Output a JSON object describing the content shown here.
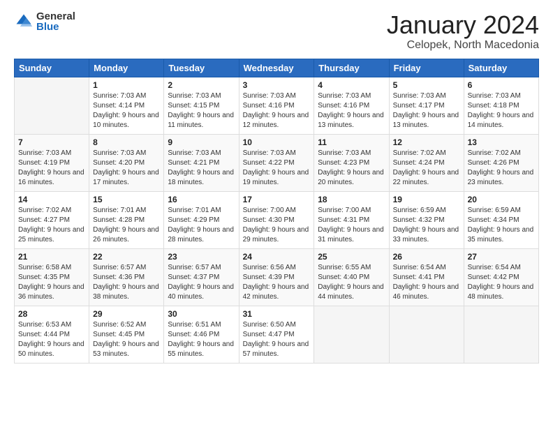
{
  "logo": {
    "general": "General",
    "blue": "Blue"
  },
  "title": "January 2024",
  "location": "Celopek, North Macedonia",
  "days_of_week": [
    "Sunday",
    "Monday",
    "Tuesday",
    "Wednesday",
    "Thursday",
    "Friday",
    "Saturday"
  ],
  "weeks": [
    [
      {
        "day": "",
        "sunrise": "",
        "sunset": "",
        "daylight": ""
      },
      {
        "day": "1",
        "sunrise": "Sunrise: 7:03 AM",
        "sunset": "Sunset: 4:14 PM",
        "daylight": "Daylight: 9 hours and 10 minutes."
      },
      {
        "day": "2",
        "sunrise": "Sunrise: 7:03 AM",
        "sunset": "Sunset: 4:15 PM",
        "daylight": "Daylight: 9 hours and 11 minutes."
      },
      {
        "day": "3",
        "sunrise": "Sunrise: 7:03 AM",
        "sunset": "Sunset: 4:16 PM",
        "daylight": "Daylight: 9 hours and 12 minutes."
      },
      {
        "day": "4",
        "sunrise": "Sunrise: 7:03 AM",
        "sunset": "Sunset: 4:16 PM",
        "daylight": "Daylight: 9 hours and 13 minutes."
      },
      {
        "day": "5",
        "sunrise": "Sunrise: 7:03 AM",
        "sunset": "Sunset: 4:17 PM",
        "daylight": "Daylight: 9 hours and 13 minutes."
      },
      {
        "day": "6",
        "sunrise": "Sunrise: 7:03 AM",
        "sunset": "Sunset: 4:18 PM",
        "daylight": "Daylight: 9 hours and 14 minutes."
      }
    ],
    [
      {
        "day": "7",
        "sunrise": "Sunrise: 7:03 AM",
        "sunset": "Sunset: 4:19 PM",
        "daylight": "Daylight: 9 hours and 16 minutes."
      },
      {
        "day": "8",
        "sunrise": "Sunrise: 7:03 AM",
        "sunset": "Sunset: 4:20 PM",
        "daylight": "Daylight: 9 hours and 17 minutes."
      },
      {
        "day": "9",
        "sunrise": "Sunrise: 7:03 AM",
        "sunset": "Sunset: 4:21 PM",
        "daylight": "Daylight: 9 hours and 18 minutes."
      },
      {
        "day": "10",
        "sunrise": "Sunrise: 7:03 AM",
        "sunset": "Sunset: 4:22 PM",
        "daylight": "Daylight: 9 hours and 19 minutes."
      },
      {
        "day": "11",
        "sunrise": "Sunrise: 7:03 AM",
        "sunset": "Sunset: 4:23 PM",
        "daylight": "Daylight: 9 hours and 20 minutes."
      },
      {
        "day": "12",
        "sunrise": "Sunrise: 7:02 AM",
        "sunset": "Sunset: 4:24 PM",
        "daylight": "Daylight: 9 hours and 22 minutes."
      },
      {
        "day": "13",
        "sunrise": "Sunrise: 7:02 AM",
        "sunset": "Sunset: 4:26 PM",
        "daylight": "Daylight: 9 hours and 23 minutes."
      }
    ],
    [
      {
        "day": "14",
        "sunrise": "Sunrise: 7:02 AM",
        "sunset": "Sunset: 4:27 PM",
        "daylight": "Daylight: 9 hours and 25 minutes."
      },
      {
        "day": "15",
        "sunrise": "Sunrise: 7:01 AM",
        "sunset": "Sunset: 4:28 PM",
        "daylight": "Daylight: 9 hours and 26 minutes."
      },
      {
        "day": "16",
        "sunrise": "Sunrise: 7:01 AM",
        "sunset": "Sunset: 4:29 PM",
        "daylight": "Daylight: 9 hours and 28 minutes."
      },
      {
        "day": "17",
        "sunrise": "Sunrise: 7:00 AM",
        "sunset": "Sunset: 4:30 PM",
        "daylight": "Daylight: 9 hours and 29 minutes."
      },
      {
        "day": "18",
        "sunrise": "Sunrise: 7:00 AM",
        "sunset": "Sunset: 4:31 PM",
        "daylight": "Daylight: 9 hours and 31 minutes."
      },
      {
        "day": "19",
        "sunrise": "Sunrise: 6:59 AM",
        "sunset": "Sunset: 4:32 PM",
        "daylight": "Daylight: 9 hours and 33 minutes."
      },
      {
        "day": "20",
        "sunrise": "Sunrise: 6:59 AM",
        "sunset": "Sunset: 4:34 PM",
        "daylight": "Daylight: 9 hours and 35 minutes."
      }
    ],
    [
      {
        "day": "21",
        "sunrise": "Sunrise: 6:58 AM",
        "sunset": "Sunset: 4:35 PM",
        "daylight": "Daylight: 9 hours and 36 minutes."
      },
      {
        "day": "22",
        "sunrise": "Sunrise: 6:57 AM",
        "sunset": "Sunset: 4:36 PM",
        "daylight": "Daylight: 9 hours and 38 minutes."
      },
      {
        "day": "23",
        "sunrise": "Sunrise: 6:57 AM",
        "sunset": "Sunset: 4:37 PM",
        "daylight": "Daylight: 9 hours and 40 minutes."
      },
      {
        "day": "24",
        "sunrise": "Sunrise: 6:56 AM",
        "sunset": "Sunset: 4:39 PM",
        "daylight": "Daylight: 9 hours and 42 minutes."
      },
      {
        "day": "25",
        "sunrise": "Sunrise: 6:55 AM",
        "sunset": "Sunset: 4:40 PM",
        "daylight": "Daylight: 9 hours and 44 minutes."
      },
      {
        "day": "26",
        "sunrise": "Sunrise: 6:54 AM",
        "sunset": "Sunset: 4:41 PM",
        "daylight": "Daylight: 9 hours and 46 minutes."
      },
      {
        "day": "27",
        "sunrise": "Sunrise: 6:54 AM",
        "sunset": "Sunset: 4:42 PM",
        "daylight": "Daylight: 9 hours and 48 minutes."
      }
    ],
    [
      {
        "day": "28",
        "sunrise": "Sunrise: 6:53 AM",
        "sunset": "Sunset: 4:44 PM",
        "daylight": "Daylight: 9 hours and 50 minutes."
      },
      {
        "day": "29",
        "sunrise": "Sunrise: 6:52 AM",
        "sunset": "Sunset: 4:45 PM",
        "daylight": "Daylight: 9 hours and 53 minutes."
      },
      {
        "day": "30",
        "sunrise": "Sunrise: 6:51 AM",
        "sunset": "Sunset: 4:46 PM",
        "daylight": "Daylight: 9 hours and 55 minutes."
      },
      {
        "day": "31",
        "sunrise": "Sunrise: 6:50 AM",
        "sunset": "Sunset: 4:47 PM",
        "daylight": "Daylight: 9 hours and 57 minutes."
      },
      {
        "day": "",
        "sunrise": "",
        "sunset": "",
        "daylight": ""
      },
      {
        "day": "",
        "sunrise": "",
        "sunset": "",
        "daylight": ""
      },
      {
        "day": "",
        "sunrise": "",
        "sunset": "",
        "daylight": ""
      }
    ]
  ]
}
